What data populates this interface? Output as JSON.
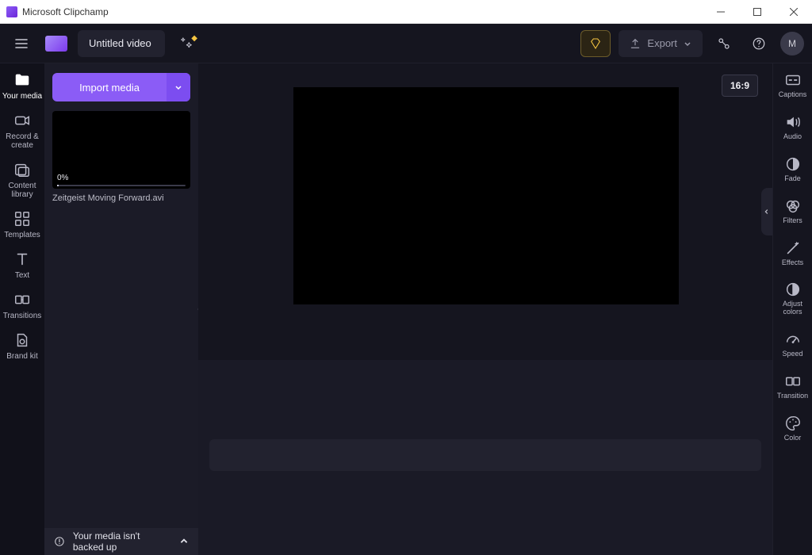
{
  "window": {
    "title": "Microsoft Clipchamp"
  },
  "toolbar": {
    "video_title": "Untitled video",
    "export_label": "Export",
    "avatar_initial": "M"
  },
  "rail": {
    "items": [
      {
        "label": "Your media"
      },
      {
        "label": "Record & create"
      },
      {
        "label": "Content library"
      },
      {
        "label": "Templates"
      },
      {
        "label": "Text"
      },
      {
        "label": "Transitions"
      },
      {
        "label": "Brand kit"
      }
    ]
  },
  "panel": {
    "import_label": "Import media",
    "media": [
      {
        "caption": "Zeitgeist Moving Forward.avi",
        "progress_label": "0%",
        "progress_pct": 0
      }
    ],
    "footer_text": "Your media isn't backed up"
  },
  "stage": {
    "aspect_label": "16:9"
  },
  "right_rail": {
    "items": [
      {
        "label": "Captions"
      },
      {
        "label": "Audio"
      },
      {
        "label": "Fade"
      },
      {
        "label": "Filters"
      },
      {
        "label": "Effects"
      },
      {
        "label": "Adjust colors"
      },
      {
        "label": "Speed"
      },
      {
        "label": "Transition"
      },
      {
        "label": "Color"
      }
    ]
  },
  "colors": {
    "accent": "#8b5cf6",
    "bg_dark": "#15151f",
    "panel_bg": "#1b1b27"
  }
}
